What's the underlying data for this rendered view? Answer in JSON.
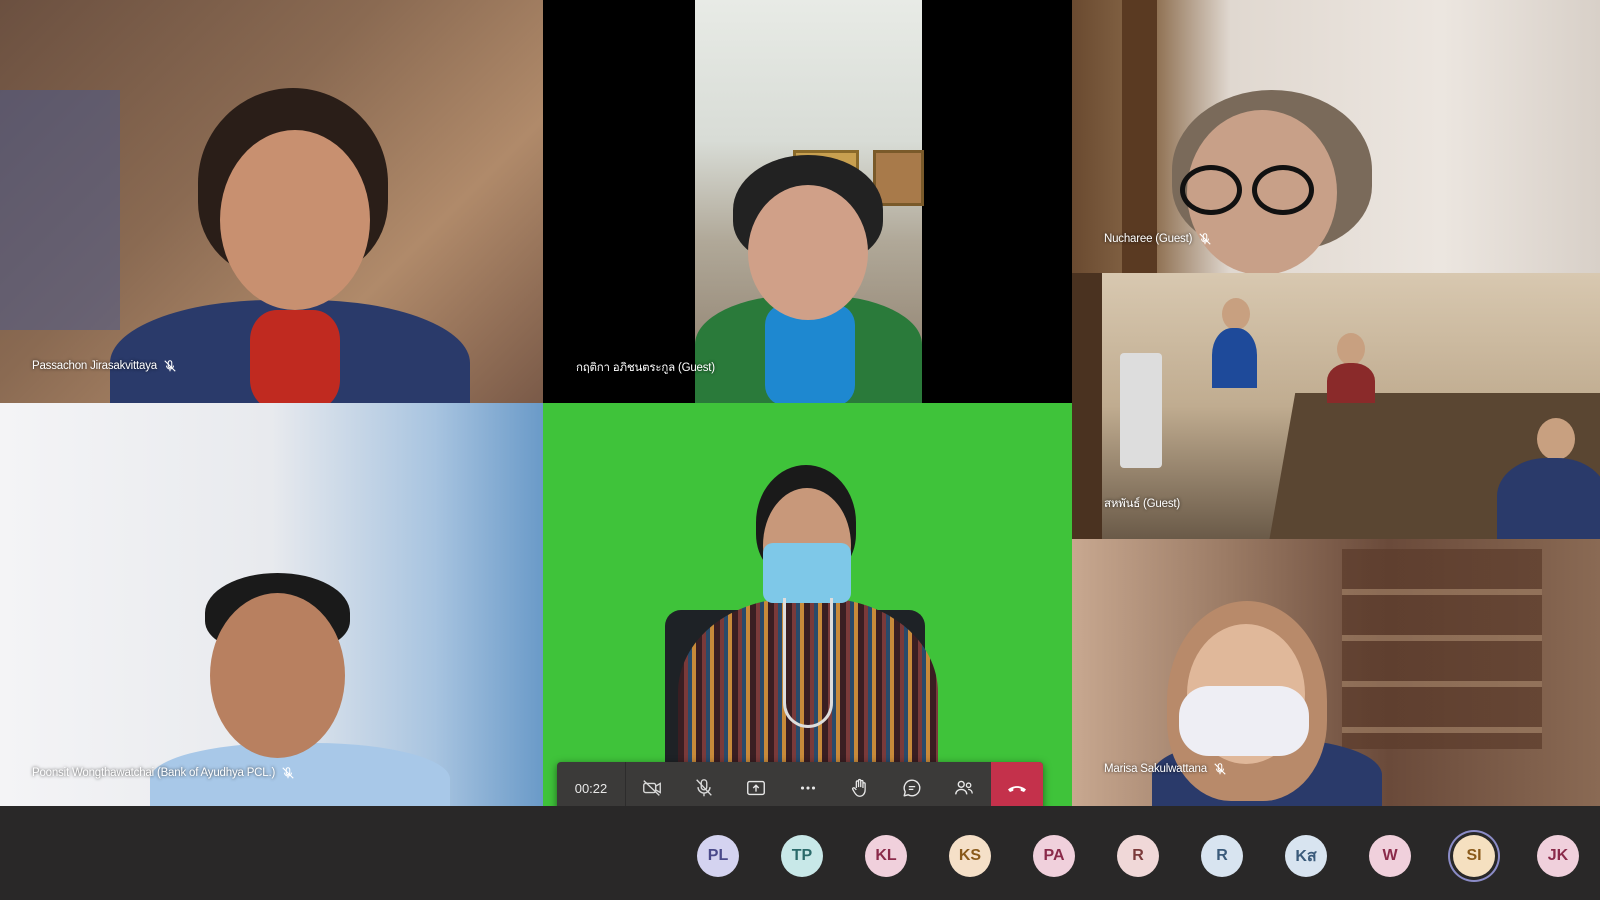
{
  "call": {
    "timer": "00:22"
  },
  "tiles": [
    {
      "name": "Passachon Jirasakvittaya",
      "muted": true
    },
    {
      "name": "กฤติกา อภิชนตระกูล (Guest)",
      "muted": false
    },
    {
      "name": "Nucharee (Guest)",
      "muted": true
    },
    {
      "name": "สหพันธ์ (Guest)",
      "muted": false
    },
    {
      "name": "Poonsit Wongthawatchai (Bank of Ayudhya PCL.)",
      "muted": true
    },
    {
      "name": "",
      "muted": false
    },
    {
      "name": "Marisa Sakulwattana",
      "muted": true
    }
  ],
  "toolbar": {
    "icons": [
      "camera-off-icon",
      "mic-off-icon",
      "share-screen-icon",
      "more-icon",
      "raise-hand-icon",
      "chat-icon",
      "participants-icon",
      "hang-up-icon"
    ]
  },
  "colors": {
    "hangup": "#c4314b",
    "green_screen": "#3fc33a",
    "bar_bg": "#292828"
  },
  "avatars": [
    {
      "initials": "PL",
      "bg": "#d4d3f0",
      "fg": "#4a4a8a",
      "selected": false
    },
    {
      "initials": "TP",
      "bg": "#c8e8e8",
      "fg": "#2a6a6a",
      "selected": false
    },
    {
      "initials": "KL",
      "bg": "#f0d0dc",
      "fg": "#8a2a4a",
      "selected": false
    },
    {
      "initials": "KS",
      "bg": "#f5e0c8",
      "fg": "#8a5a1a",
      "selected": false
    },
    {
      "initials": "PA",
      "bg": "#f0d0dc",
      "fg": "#8a2a4a",
      "selected": false
    },
    {
      "initials": "R",
      "bg": "#f0d8d8",
      "fg": "#7a3a3a",
      "selected": false
    },
    {
      "initials": "R",
      "bg": "#d8e4f0",
      "fg": "#3a5a7a",
      "selected": false
    },
    {
      "initials": "Kส",
      "bg": "#d8e4f0",
      "fg": "#3a5a7a",
      "selected": false
    },
    {
      "initials": "W",
      "bg": "#f0d0dc",
      "fg": "#8a2a4a",
      "selected": false
    },
    {
      "initials": "SI",
      "bg": "#f5e0c0",
      "fg": "#8a5a1a",
      "selected": true
    },
    {
      "initials": "JK",
      "bg": "#f0d0dc",
      "fg": "#8a2a4a",
      "selected": false
    }
  ]
}
